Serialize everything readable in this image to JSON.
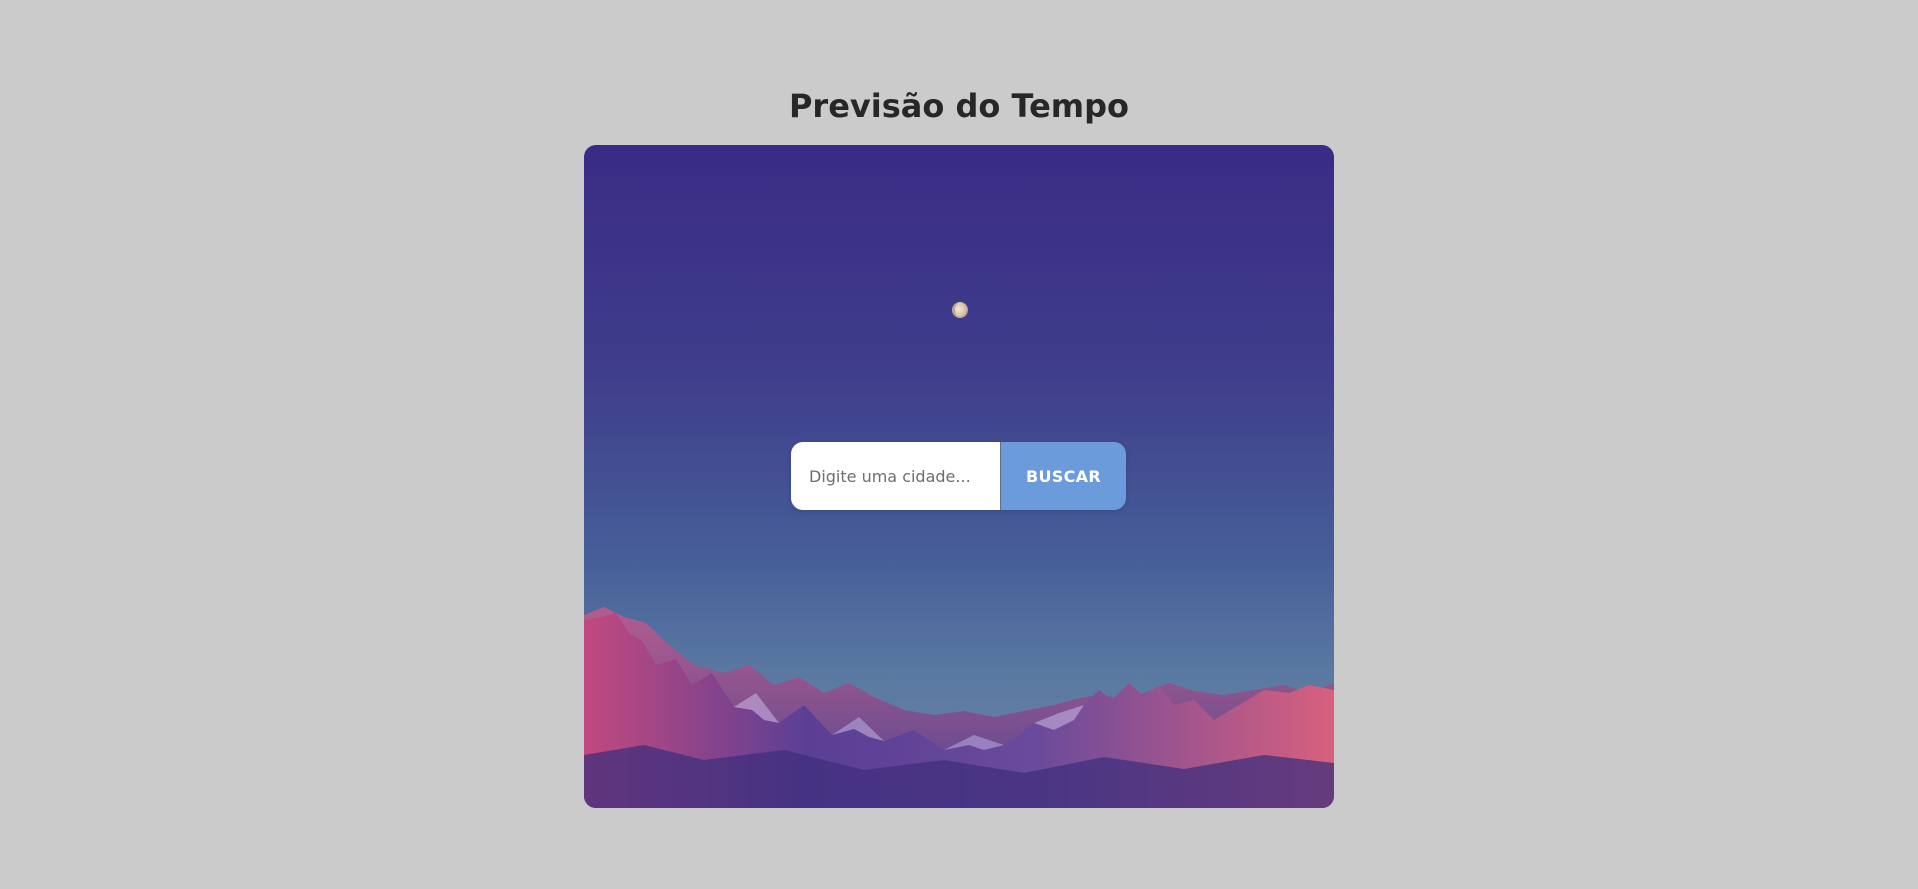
{
  "header": {
    "title": "Previsão do Tempo"
  },
  "search": {
    "placeholder": "Digite uma cidade...",
    "value": "",
    "button_label": "BUSCAR"
  },
  "colors": {
    "page_background": "#cbcbcb",
    "title_text": "#282626",
    "button_background": "#6b9bdb",
    "button_text": "#ffffff",
    "input_background": "#ffffff"
  }
}
